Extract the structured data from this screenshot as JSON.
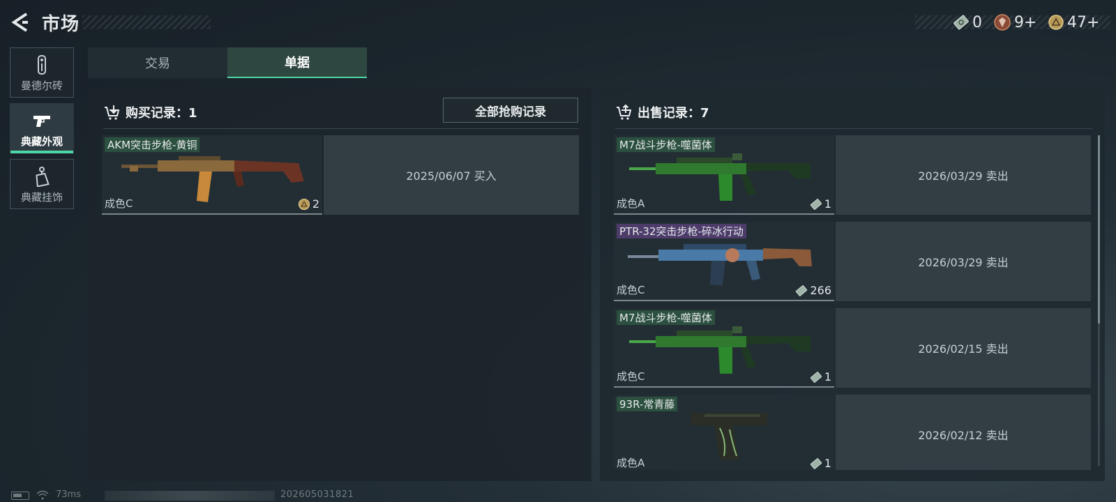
{
  "header": {
    "title": "市场",
    "currencies": [
      {
        "icon": "cash-note-icon",
        "amount": "0"
      },
      {
        "icon": "gem-badge-icon",
        "amount": "9+"
      },
      {
        "icon": "coin-icon",
        "amount": "47+"
      }
    ]
  },
  "categories": [
    {
      "label": "曼德尔砖",
      "icon": "mandel-brick-icon",
      "active": false
    },
    {
      "label": "典藏外观",
      "icon": "pistol-icon",
      "active": true
    },
    {
      "label": "典藏挂饰",
      "icon": "charm-icon",
      "active": false
    }
  ],
  "tabs": [
    {
      "label": "交易",
      "active": false
    },
    {
      "label": "单据",
      "active": true
    }
  ],
  "purchases": {
    "title": "购买记录：1",
    "all_button": "全部抢购记录",
    "records": [
      {
        "name": "AKM突击步枪-黄铜",
        "grade": "成色C",
        "price": "2",
        "price_icon": "coin-icon",
        "date": "2025/06/07 买入",
        "art": "akm-rifle-icon"
      }
    ]
  },
  "sales": {
    "title": "出售记录：7",
    "records": [
      {
        "name": "M7战斗步枪-噬菌体",
        "grade": "成色A",
        "price": "1",
        "price_icon": "cash-note-icon",
        "date": "2026/03/29 卖出",
        "art": "green-rifle-icon"
      },
      {
        "name": "PTR-32突击步枪-碎冰行动",
        "grade": "成色C",
        "price": "266",
        "price_icon": "cash-note-icon",
        "date": "2026/03/29 卖出",
        "art": "blue-rifle-icon"
      },
      {
        "name": "M7战斗步枪-噬菌体",
        "grade": "成色C",
        "price": "1",
        "price_icon": "cash-note-icon",
        "date": "2026/02/15 卖出",
        "art": "green-rifle-icon"
      },
      {
        "name": "93R-常青藤",
        "grade": "成色A",
        "price": "1",
        "price_icon": "cash-note-icon",
        "date": "2026/02/12 卖出",
        "art": "ivy-pistol-icon"
      }
    ]
  },
  "footer": {
    "ping": "73ms",
    "build": "202605031821"
  },
  "colors": {
    "accent": "#4fd6a6",
    "panel": "#1c252b",
    "date_box": "#333e44"
  }
}
